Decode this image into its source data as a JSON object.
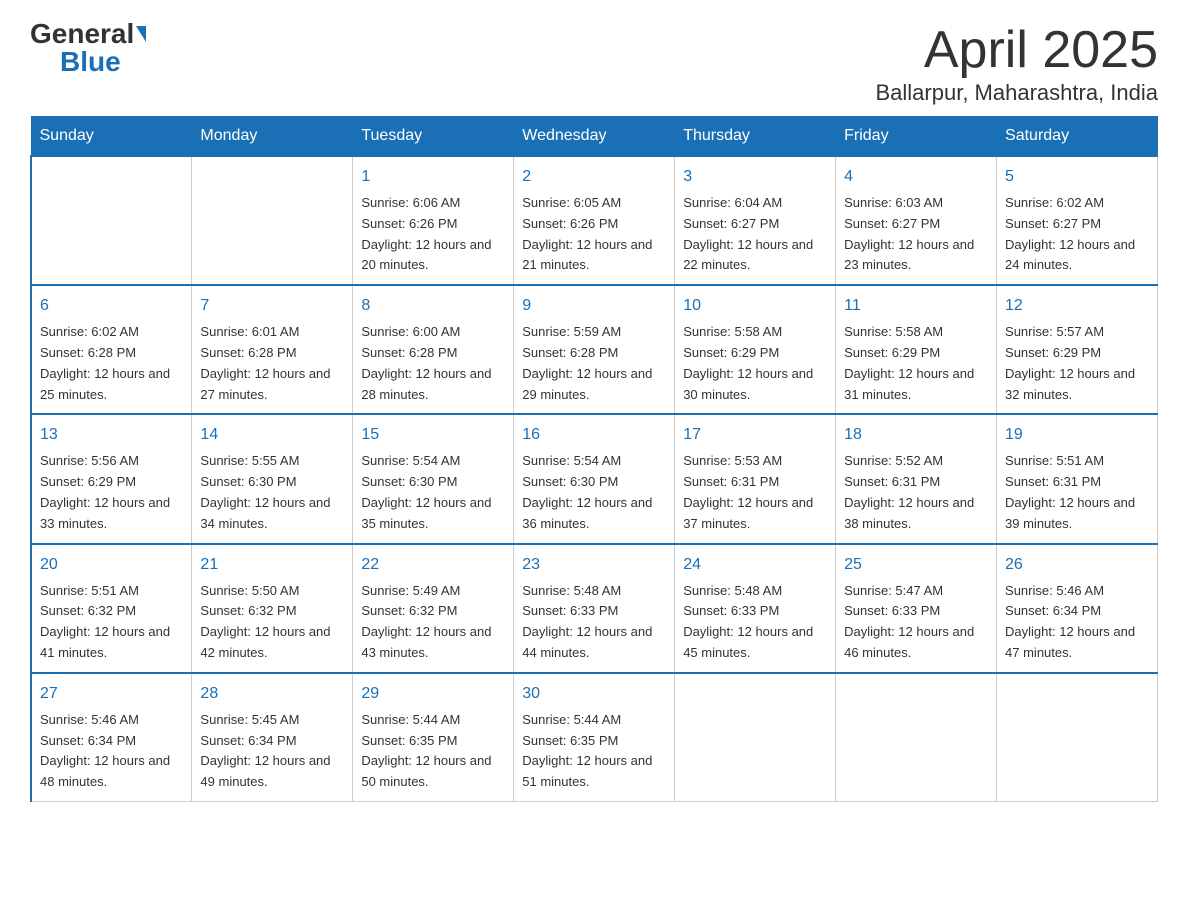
{
  "header": {
    "logo_general": "General",
    "logo_blue": "Blue",
    "title_month": "April 2025",
    "title_location": "Ballarpur, Maharashtra, India"
  },
  "weekdays": [
    "Sunday",
    "Monday",
    "Tuesday",
    "Wednesday",
    "Thursday",
    "Friday",
    "Saturday"
  ],
  "weeks": [
    [
      {
        "day": "",
        "sunrise": "",
        "sunset": "",
        "daylight": ""
      },
      {
        "day": "",
        "sunrise": "",
        "sunset": "",
        "daylight": ""
      },
      {
        "day": "1",
        "sunrise": "Sunrise: 6:06 AM",
        "sunset": "Sunset: 6:26 PM",
        "daylight": "Daylight: 12 hours and 20 minutes."
      },
      {
        "day": "2",
        "sunrise": "Sunrise: 6:05 AM",
        "sunset": "Sunset: 6:26 PM",
        "daylight": "Daylight: 12 hours and 21 minutes."
      },
      {
        "day": "3",
        "sunrise": "Sunrise: 6:04 AM",
        "sunset": "Sunset: 6:27 PM",
        "daylight": "Daylight: 12 hours and 22 minutes."
      },
      {
        "day": "4",
        "sunrise": "Sunrise: 6:03 AM",
        "sunset": "Sunset: 6:27 PM",
        "daylight": "Daylight: 12 hours and 23 minutes."
      },
      {
        "day": "5",
        "sunrise": "Sunrise: 6:02 AM",
        "sunset": "Sunset: 6:27 PM",
        "daylight": "Daylight: 12 hours and 24 minutes."
      }
    ],
    [
      {
        "day": "6",
        "sunrise": "Sunrise: 6:02 AM",
        "sunset": "Sunset: 6:28 PM",
        "daylight": "Daylight: 12 hours and 25 minutes."
      },
      {
        "day": "7",
        "sunrise": "Sunrise: 6:01 AM",
        "sunset": "Sunset: 6:28 PM",
        "daylight": "Daylight: 12 hours and 27 minutes."
      },
      {
        "day": "8",
        "sunrise": "Sunrise: 6:00 AM",
        "sunset": "Sunset: 6:28 PM",
        "daylight": "Daylight: 12 hours and 28 minutes."
      },
      {
        "day": "9",
        "sunrise": "Sunrise: 5:59 AM",
        "sunset": "Sunset: 6:28 PM",
        "daylight": "Daylight: 12 hours and 29 minutes."
      },
      {
        "day": "10",
        "sunrise": "Sunrise: 5:58 AM",
        "sunset": "Sunset: 6:29 PM",
        "daylight": "Daylight: 12 hours and 30 minutes."
      },
      {
        "day": "11",
        "sunrise": "Sunrise: 5:58 AM",
        "sunset": "Sunset: 6:29 PM",
        "daylight": "Daylight: 12 hours and 31 minutes."
      },
      {
        "day": "12",
        "sunrise": "Sunrise: 5:57 AM",
        "sunset": "Sunset: 6:29 PM",
        "daylight": "Daylight: 12 hours and 32 minutes."
      }
    ],
    [
      {
        "day": "13",
        "sunrise": "Sunrise: 5:56 AM",
        "sunset": "Sunset: 6:29 PM",
        "daylight": "Daylight: 12 hours and 33 minutes."
      },
      {
        "day": "14",
        "sunrise": "Sunrise: 5:55 AM",
        "sunset": "Sunset: 6:30 PM",
        "daylight": "Daylight: 12 hours and 34 minutes."
      },
      {
        "day": "15",
        "sunrise": "Sunrise: 5:54 AM",
        "sunset": "Sunset: 6:30 PM",
        "daylight": "Daylight: 12 hours and 35 minutes."
      },
      {
        "day": "16",
        "sunrise": "Sunrise: 5:54 AM",
        "sunset": "Sunset: 6:30 PM",
        "daylight": "Daylight: 12 hours and 36 minutes."
      },
      {
        "day": "17",
        "sunrise": "Sunrise: 5:53 AM",
        "sunset": "Sunset: 6:31 PM",
        "daylight": "Daylight: 12 hours and 37 minutes."
      },
      {
        "day": "18",
        "sunrise": "Sunrise: 5:52 AM",
        "sunset": "Sunset: 6:31 PM",
        "daylight": "Daylight: 12 hours and 38 minutes."
      },
      {
        "day": "19",
        "sunrise": "Sunrise: 5:51 AM",
        "sunset": "Sunset: 6:31 PM",
        "daylight": "Daylight: 12 hours and 39 minutes."
      }
    ],
    [
      {
        "day": "20",
        "sunrise": "Sunrise: 5:51 AM",
        "sunset": "Sunset: 6:32 PM",
        "daylight": "Daylight: 12 hours and 41 minutes."
      },
      {
        "day": "21",
        "sunrise": "Sunrise: 5:50 AM",
        "sunset": "Sunset: 6:32 PM",
        "daylight": "Daylight: 12 hours and 42 minutes."
      },
      {
        "day": "22",
        "sunrise": "Sunrise: 5:49 AM",
        "sunset": "Sunset: 6:32 PM",
        "daylight": "Daylight: 12 hours and 43 minutes."
      },
      {
        "day": "23",
        "sunrise": "Sunrise: 5:48 AM",
        "sunset": "Sunset: 6:33 PM",
        "daylight": "Daylight: 12 hours and 44 minutes."
      },
      {
        "day": "24",
        "sunrise": "Sunrise: 5:48 AM",
        "sunset": "Sunset: 6:33 PM",
        "daylight": "Daylight: 12 hours and 45 minutes."
      },
      {
        "day": "25",
        "sunrise": "Sunrise: 5:47 AM",
        "sunset": "Sunset: 6:33 PM",
        "daylight": "Daylight: 12 hours and 46 minutes."
      },
      {
        "day": "26",
        "sunrise": "Sunrise: 5:46 AM",
        "sunset": "Sunset: 6:34 PM",
        "daylight": "Daylight: 12 hours and 47 minutes."
      }
    ],
    [
      {
        "day": "27",
        "sunrise": "Sunrise: 5:46 AM",
        "sunset": "Sunset: 6:34 PM",
        "daylight": "Daylight: 12 hours and 48 minutes."
      },
      {
        "day": "28",
        "sunrise": "Sunrise: 5:45 AM",
        "sunset": "Sunset: 6:34 PM",
        "daylight": "Daylight: 12 hours and 49 minutes."
      },
      {
        "day": "29",
        "sunrise": "Sunrise: 5:44 AM",
        "sunset": "Sunset: 6:35 PM",
        "daylight": "Daylight: 12 hours and 50 minutes."
      },
      {
        "day": "30",
        "sunrise": "Sunrise: 5:44 AM",
        "sunset": "Sunset: 6:35 PM",
        "daylight": "Daylight: 12 hours and 51 minutes."
      },
      {
        "day": "",
        "sunrise": "",
        "sunset": "",
        "daylight": ""
      },
      {
        "day": "",
        "sunrise": "",
        "sunset": "",
        "daylight": ""
      },
      {
        "day": "",
        "sunrise": "",
        "sunset": "",
        "daylight": ""
      }
    ]
  ]
}
